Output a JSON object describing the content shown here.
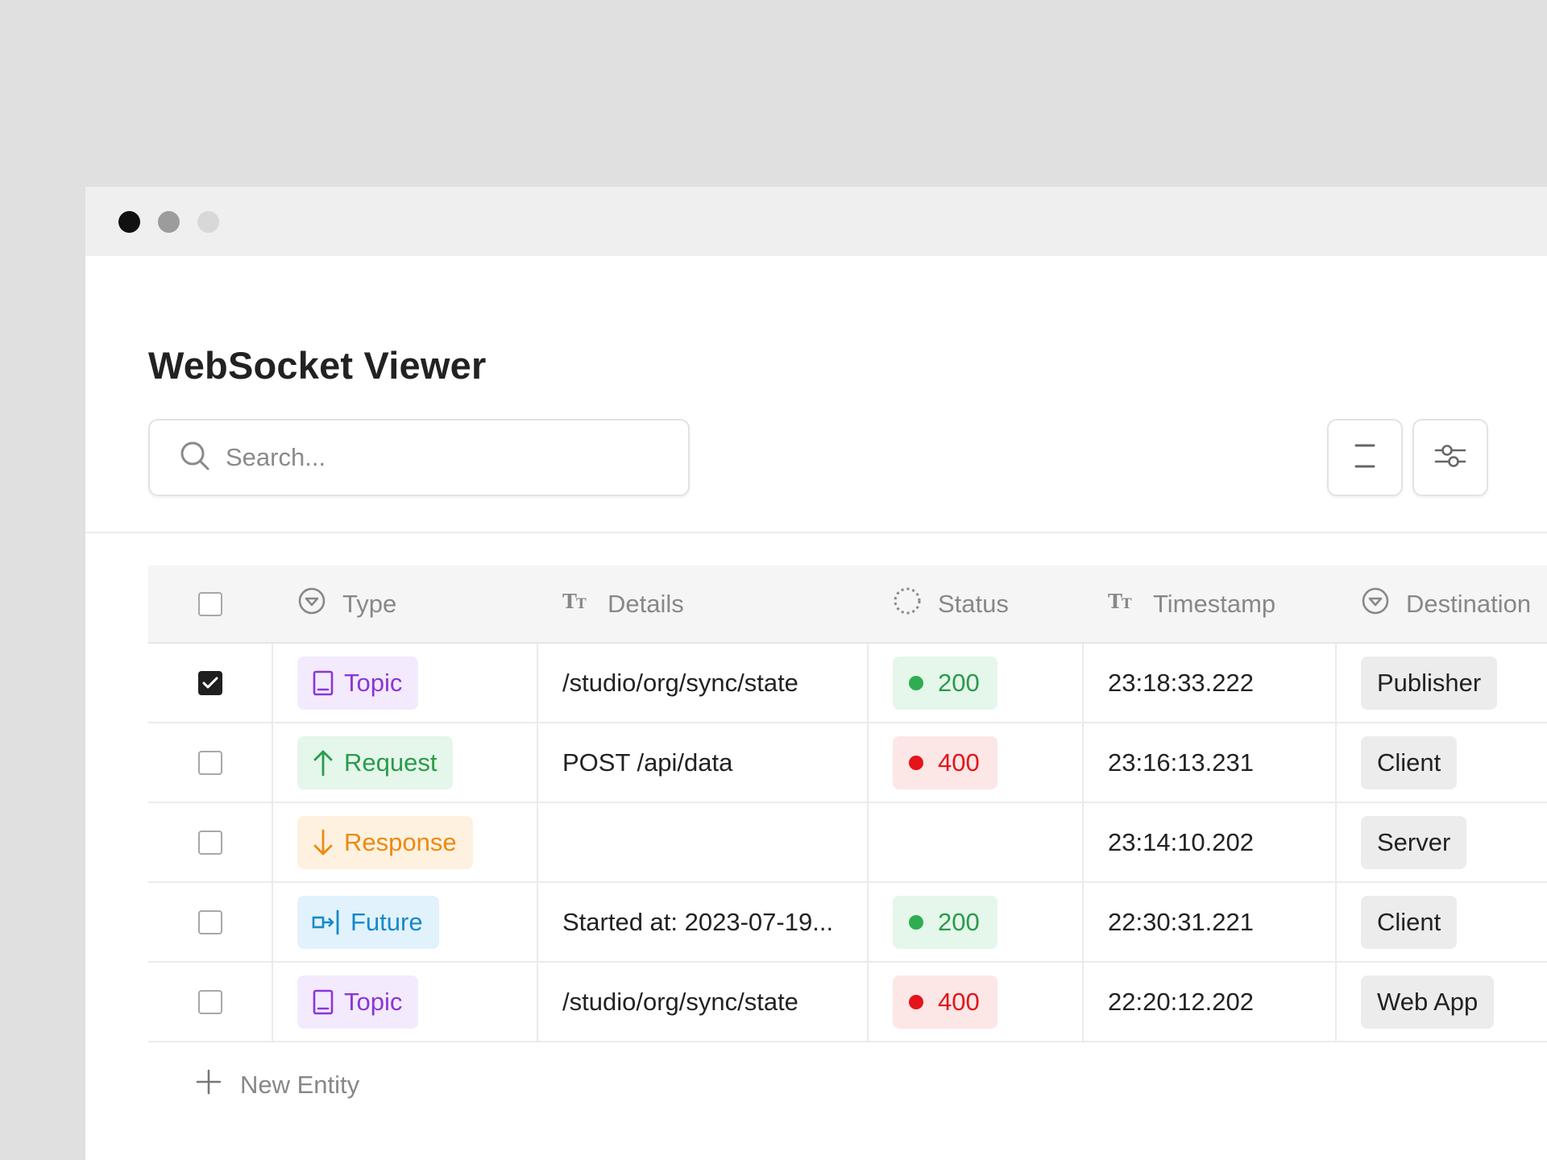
{
  "window": {
    "controls": [
      "close",
      "minimize",
      "maximize"
    ]
  },
  "page": {
    "title": "WebSocket Viewer"
  },
  "search": {
    "placeholder": "Search...",
    "value": ""
  },
  "toolbar": {
    "density_icon": "rows-icon",
    "filter_icon": "sliders-icon"
  },
  "table": {
    "columns": [
      {
        "label": "Type",
        "icon": "select-column-icon"
      },
      {
        "label": "Details",
        "icon": "text-column-icon"
      },
      {
        "label": "Status",
        "icon": "status-column-icon"
      },
      {
        "label": "Timestamp",
        "icon": "text-column-icon"
      },
      {
        "label": "Destination",
        "icon": "select-column-icon"
      }
    ],
    "rows": [
      {
        "checked": true,
        "type": "Topic",
        "type_icon": "document-icon",
        "details": "/studio/org/sync/state",
        "status": "200",
        "status_kind": "ok",
        "timestamp": "23:18:33.222",
        "destination": "Publisher"
      },
      {
        "checked": false,
        "type": "Request",
        "type_icon": "arrow-up-icon",
        "details": "POST /api/data",
        "status": "400",
        "status_kind": "err",
        "timestamp": "23:16:13.231",
        "destination": "Client"
      },
      {
        "checked": false,
        "type": "Response",
        "type_icon": "arrow-down-icon",
        "details": "",
        "status": "",
        "status_kind": "",
        "timestamp": "23:14:10.202",
        "destination": "Server"
      },
      {
        "checked": false,
        "type": "Future",
        "type_icon": "future-icon",
        "details": "Started at: 2023-07-19...",
        "status": "200",
        "status_kind": "ok",
        "timestamp": "22:30:31.221",
        "destination": "Client"
      },
      {
        "checked": false,
        "type": "Topic",
        "type_icon": "document-icon",
        "details": "/studio/org/sync/state",
        "status": "400",
        "status_kind": "err",
        "timestamp": "22:20:12.202",
        "destination": "Web App"
      }
    ]
  },
  "footer": {
    "new_entity_label": "New Entity"
  },
  "colors": {
    "topic": "#8b36d6",
    "request": "#2a9b4b",
    "response": "#ec8a10",
    "future": "#1689c9",
    "status_ok": "#2fad52",
    "status_err": "#e4141a"
  }
}
